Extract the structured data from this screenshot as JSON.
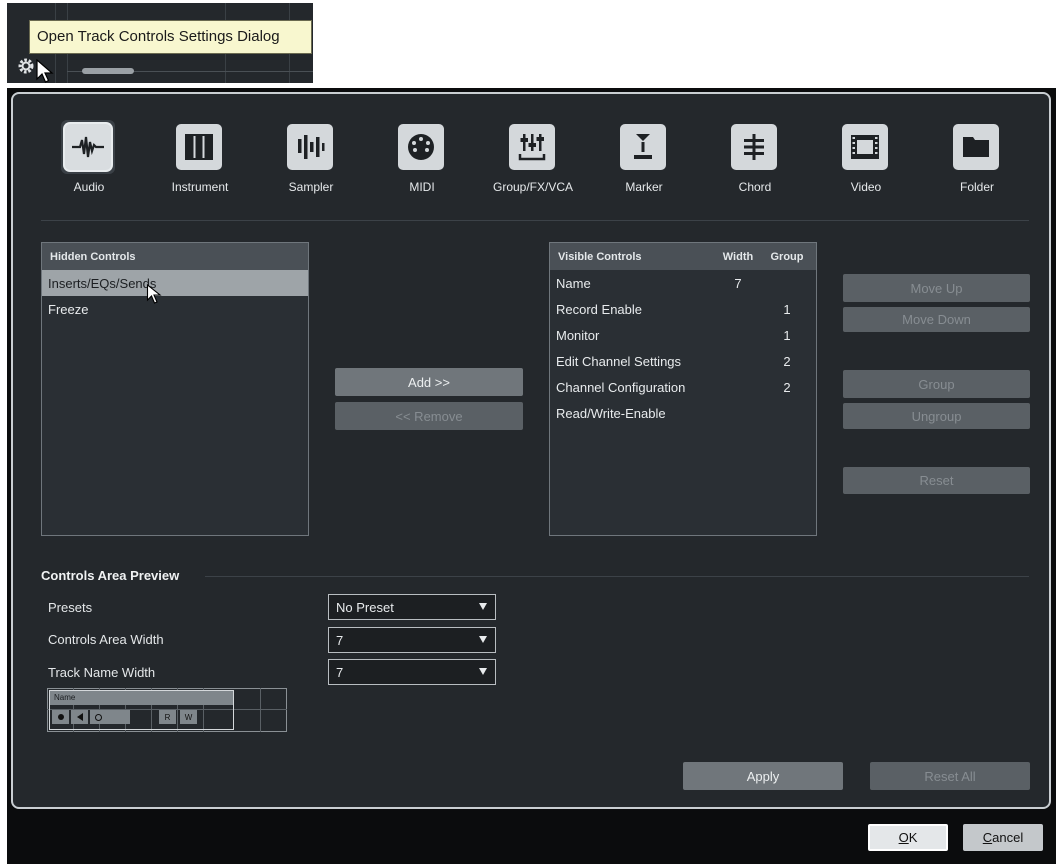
{
  "tooltip": "Open Track Controls Settings Dialog",
  "track_types": [
    {
      "label": "Audio",
      "icon": "audio-waveform-icon"
    },
    {
      "label": "Instrument",
      "icon": "piano-keys-icon"
    },
    {
      "label": "Sampler",
      "icon": "sampler-icon"
    },
    {
      "label": "MIDI",
      "icon": "midi-connector-icon"
    },
    {
      "label": "Group/FX/VCA",
      "icon": "mixer-faders-icon"
    },
    {
      "label": "Marker",
      "icon": "marker-icon"
    },
    {
      "label": "Chord",
      "icon": "chord-icon"
    },
    {
      "label": "Video",
      "icon": "film-icon"
    },
    {
      "label": "Folder",
      "icon": "folder-icon"
    }
  ],
  "hidden_controls": {
    "header": "Hidden Controls",
    "items": [
      "Inserts/EQs/Sends",
      "Freeze"
    ]
  },
  "visible_controls": {
    "headers": {
      "name": "Visible Controls",
      "width": "Width",
      "group": "Group"
    },
    "rows": [
      {
        "name": "Name",
        "width": "7",
        "group": ""
      },
      {
        "name": "Record Enable",
        "width": "",
        "group": "1"
      },
      {
        "name": "Monitor",
        "width": "",
        "group": "1"
      },
      {
        "name": "Edit Channel Settings",
        "width": "",
        "group": "2"
      },
      {
        "name": "Channel Configuration",
        "width": "",
        "group": "2"
      },
      {
        "name": "Read/Write-Enable",
        "width": "",
        "group": ""
      }
    ]
  },
  "buttons": {
    "add": "Add >>",
    "remove": "<< Remove",
    "move_up": "Move Up",
    "move_down": "Move Down",
    "group": "Group",
    "ungroup": "Ungroup",
    "reset": "Reset",
    "apply": "Apply",
    "reset_all": "Reset All",
    "ok_u": "O",
    "ok_rest": "K",
    "cancel_u": "C",
    "cancel_rest": "ancel"
  },
  "preview": {
    "section_title": "Controls Area Preview",
    "presets_label": "Presets",
    "presets_value": "No Preset",
    "controls_width_label": "Controls Area Width",
    "controls_width_value": "7",
    "track_name_width_label": "Track Name Width",
    "track_name_width_value": "7",
    "mini_name": "Name",
    "mini_read": "R",
    "mini_write": "W"
  },
  "colors": {
    "panel": "#24282c",
    "tooltip_bg": "#f8f7cf",
    "selected_row": "#9ea4a8",
    "button": "#70767b"
  }
}
